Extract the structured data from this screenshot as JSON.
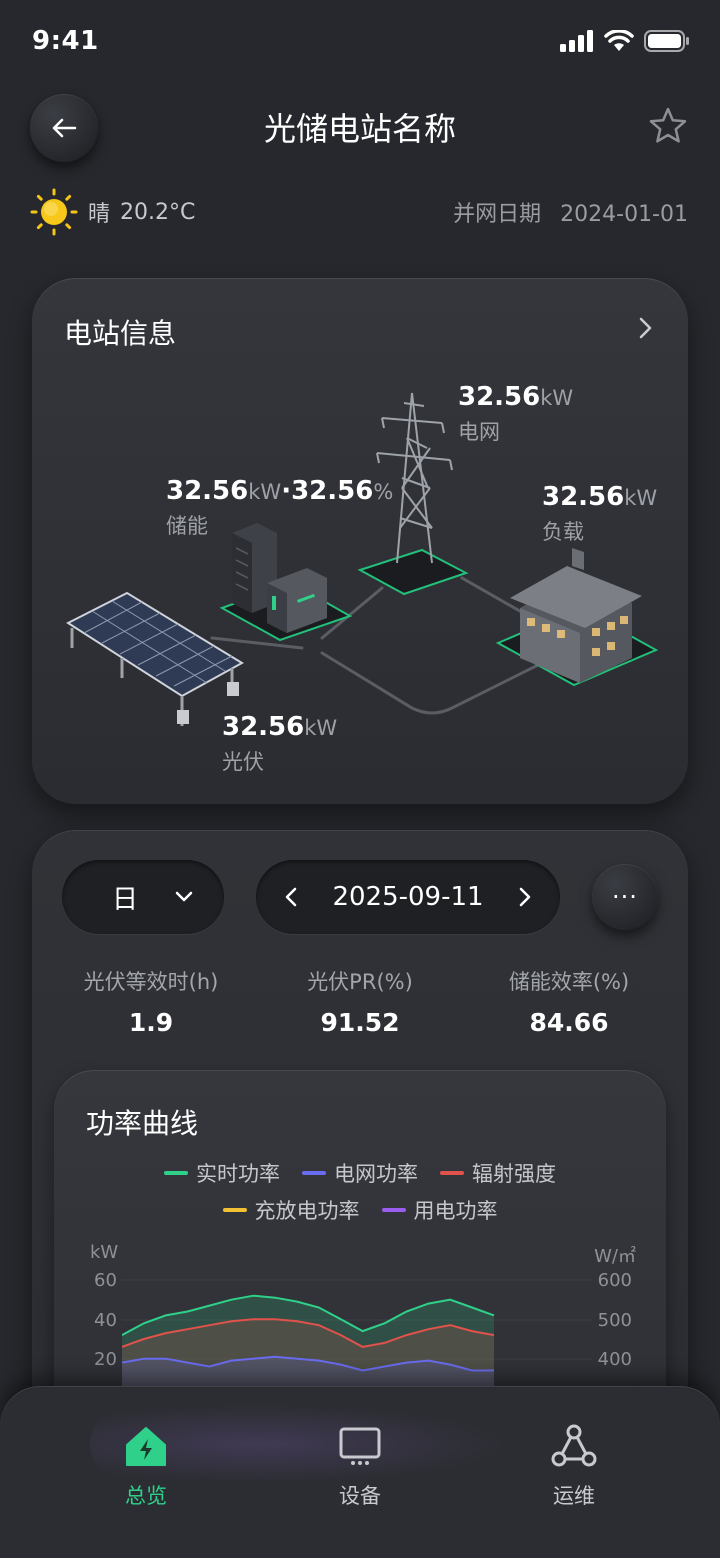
{
  "status_bar": {
    "time": "9:41"
  },
  "header": {
    "title": "光储电站名称"
  },
  "weather": {
    "condition": "晴",
    "temperature": "20.2°C"
  },
  "grid_connection": {
    "label": "并网日期",
    "date": "2024-01-01"
  },
  "station_info": {
    "title": "电站信息",
    "storage": {
      "value": "32.56",
      "unit": "kW",
      "separator": "·",
      "soc": "32.56",
      "soc_unit": "%",
      "label": "储能"
    },
    "grid": {
      "value": "32.56",
      "unit": "kW",
      "label": "电网"
    },
    "load": {
      "value": "32.56",
      "unit": "kW",
      "label": "负载"
    },
    "pv": {
      "value": "32.56",
      "unit": "kW",
      "label": "光伏"
    }
  },
  "filters": {
    "period": "日",
    "date": "2025-09-11",
    "more": "···"
  },
  "kpis": [
    {
      "label": "光伏等效时(h)",
      "value": "1.9"
    },
    {
      "label": "光伏PR(%)",
      "value": "91.52"
    },
    {
      "label": "储能效率(%)",
      "value": "84.66"
    }
  ],
  "power_chart": {
    "title": "功率曲线",
    "legend": [
      {
        "name": "实时功率",
        "color": "#2fd18a"
      },
      {
        "name": "电网功率",
        "color": "#6a6cf0"
      },
      {
        "name": "辐射强度",
        "color": "#e0524a"
      },
      {
        "name": "充放电功率",
        "color": "#f2c232"
      },
      {
        "name": "用电功率",
        "color": "#9b5cf0"
      }
    ],
    "y_left_unit": "kW",
    "y_right_unit": "W/㎡",
    "y_left_ticks": [
      "60",
      "40",
      "20"
    ],
    "y_right_ticks": [
      "600",
      "500",
      "400"
    ]
  },
  "chart_data": {
    "type": "area",
    "title": "功率曲线",
    "ylabel": "kW",
    "ylabel_right": "W/㎡",
    "ylim": [
      0,
      60
    ],
    "ylim_right": [
      300,
      600
    ],
    "series": [
      {
        "name": "实时功率",
        "values": [
          32,
          38,
          42,
          44,
          47,
          50,
          52,
          51,
          49,
          46,
          40,
          34,
          38,
          44,
          48,
          50,
          46,
          42
        ]
      },
      {
        "name": "辐射强度",
        "values": [
          26,
          30,
          33,
          35,
          37,
          39,
          40,
          40,
          39,
          37,
          32,
          26,
          28,
          32,
          35,
          37,
          34,
          32
        ]
      },
      {
        "name": "电网功率",
        "values": [
          18,
          20,
          20,
          18,
          16,
          19,
          20,
          21,
          20,
          19,
          17,
          14,
          16,
          18,
          19,
          17,
          14,
          14
        ]
      }
    ]
  },
  "tabbar": {
    "items": [
      {
        "label": "总览"
      },
      {
        "label": "设备"
      },
      {
        "label": "运维"
      }
    ]
  }
}
